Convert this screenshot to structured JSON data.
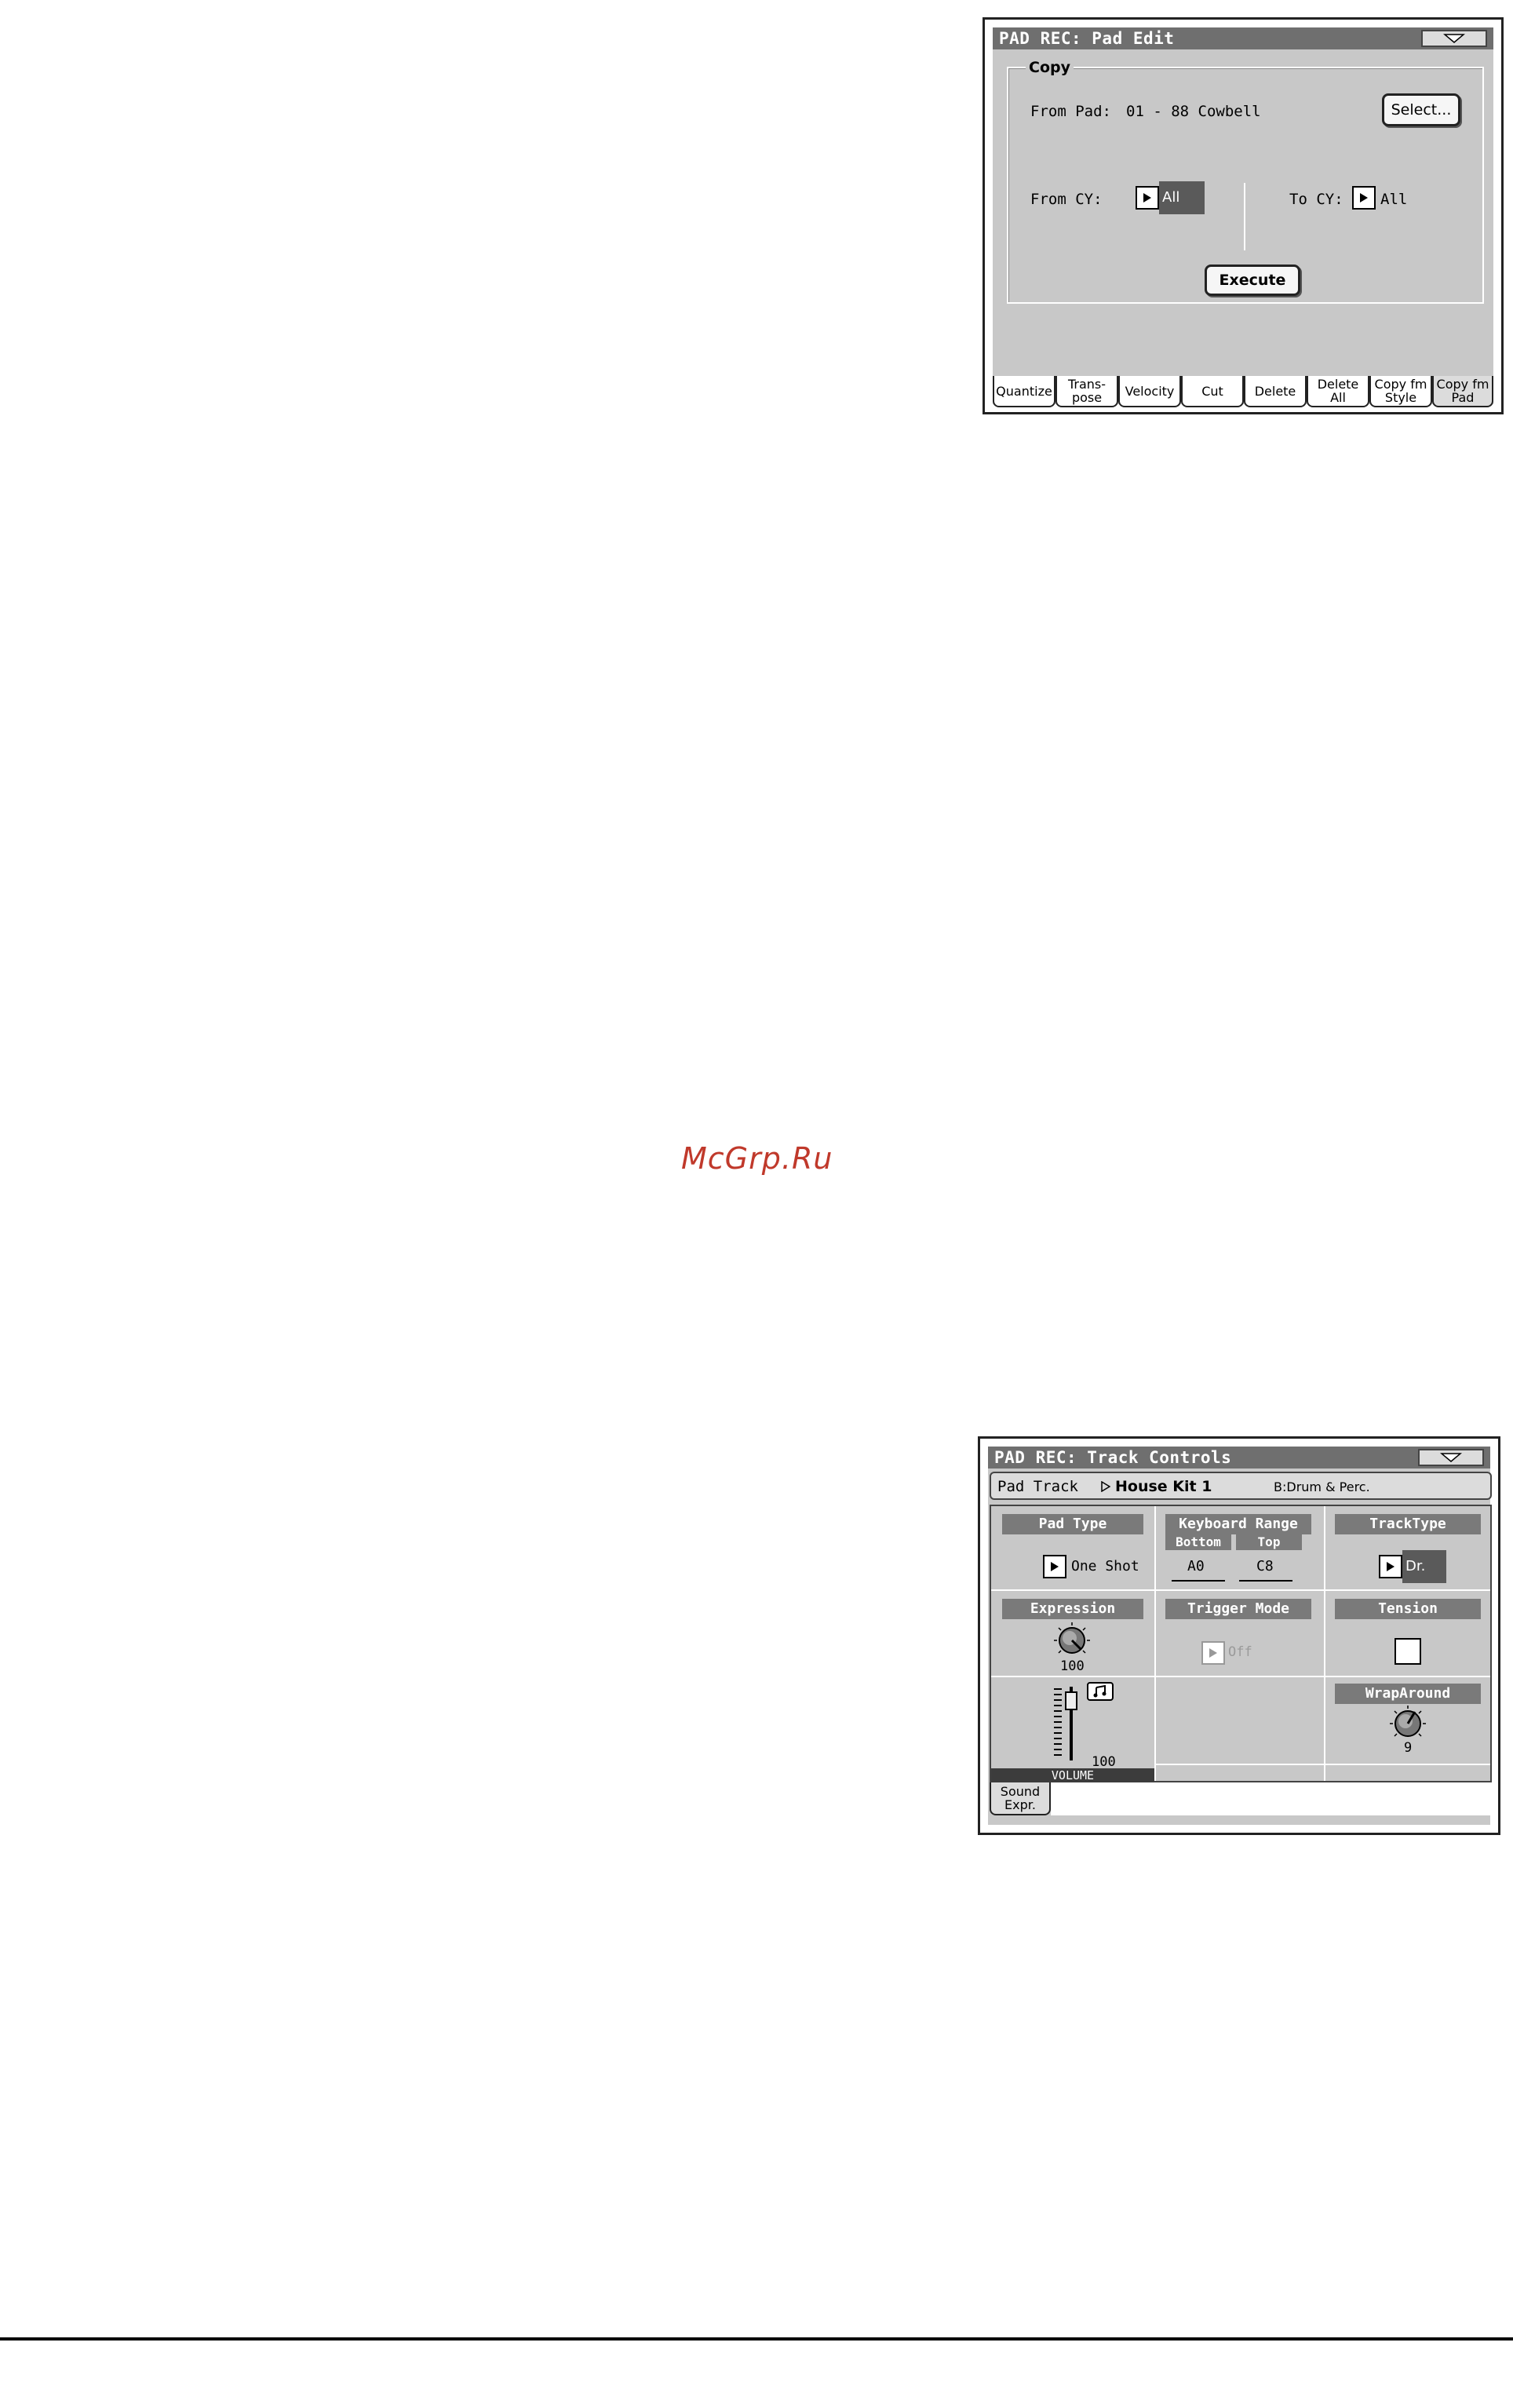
{
  "pad_edit": {
    "title": "PAD REC: Pad Edit",
    "copy_label": "Copy",
    "from_pad_label": "From Pad:",
    "from_pad_value": "01 - 88 Cowbell",
    "select_button": "Select...",
    "from_cy_label": "From CY:",
    "from_cy_value": "All",
    "to_cy_label": "To CY:",
    "to_cy_value": "All",
    "execute_button": "Execute",
    "tabs": [
      {
        "line1": "Quantize",
        "line2": ""
      },
      {
        "line1": "Trans-",
        "line2": "pose"
      },
      {
        "line1": "Velocity",
        "line2": ""
      },
      {
        "line1": "Cut",
        "line2": ""
      },
      {
        "line1": "Delete",
        "line2": ""
      },
      {
        "line1": "Delete",
        "line2": "All"
      },
      {
        "line1": "Copy fm",
        "line2": "Style"
      },
      {
        "line1": "Copy fm",
        "line2": "Pad"
      }
    ]
  },
  "track_controls": {
    "title": "PAD REC: Track Controls",
    "pad_track_label": "Pad Track",
    "kit_name": "House Kit 1",
    "kit_category": "B:Drum & Perc.",
    "pad_type_header": "Pad Type",
    "pad_type_value": "One Shot",
    "keyboard_range_header": "Keyboard Range",
    "bottom_header": "Bottom",
    "top_header": "Top",
    "bottom_value": "A0",
    "top_value": "C8",
    "track_type_header": "TrackType",
    "track_type_value": "Dr.",
    "expression_header": "Expression",
    "expression_value": "100",
    "trigger_mode_header": "Trigger Mode",
    "trigger_mode_value": "Off",
    "tension_header": "Tension",
    "volume_value": "100",
    "volume_label": "VOLUME",
    "wraparound_header": "WrapAround",
    "wraparound_value": "9",
    "tab_label_1": "Sound",
    "tab_label_2": "Expr."
  },
  "watermark": "McGrp.Ru"
}
